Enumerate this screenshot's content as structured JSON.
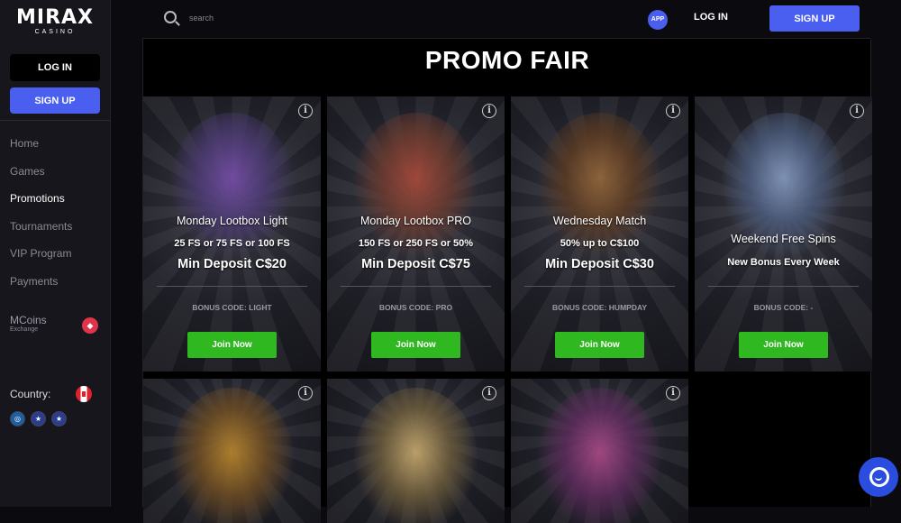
{
  "sidebar": {
    "logo_main": "MIRAX",
    "logo_sub": "CASINO",
    "login_label": "LOG IN",
    "signup_label": "SIGN UP",
    "nav": [
      {
        "label": "Home",
        "active": false
      },
      {
        "label": "Games",
        "active": false
      },
      {
        "label": "Promotions",
        "active": true
      },
      {
        "label": "Tournaments",
        "active": false
      },
      {
        "label": "VIP Program",
        "active": false
      },
      {
        "label": "Payments",
        "active": false
      }
    ],
    "mcoins_label": "MCoins",
    "mcoins_sub": "Exchange",
    "country_label": "Country:"
  },
  "header": {
    "search_placeholder": "search",
    "app_label": "APP",
    "login_label": "LOG IN",
    "signup_label": "SIGN UP"
  },
  "main": {
    "title": "PROMO FAIR",
    "cards": [
      {
        "title": "Monday Lootbox Light",
        "offer": "25 FS or 75 FS or 100 FS",
        "min": "Min Deposit C$20",
        "code": "BONUS CODE: LIGHT",
        "button": "Join Now",
        "art_color": "#7a4fb0"
      },
      {
        "title": "Monday Lootbox PRO",
        "offer": "150 FS or 250 FS or 50%",
        "min": "Min Deposit C$75",
        "code": "BONUS CODE: PRO",
        "button": "Join Now",
        "art_color": "#b04a3a"
      },
      {
        "title": "Wednesday Match",
        "offer": "50% up to C$100",
        "min": "Min Deposit C$30",
        "code": "BONUS CODE: HUMPDAY",
        "button": "Join Now",
        "art_color": "#9a6a3a"
      },
      {
        "title": "Weekend Free Spins",
        "offer": "New Bonus Every Week",
        "min": "",
        "code": "BONUS CODE: -",
        "button": "Join Now",
        "art_color": "#8aa0c8"
      }
    ]
  },
  "colors": {
    "accent": "#4a5ef0",
    "join_green": "#2fb81f"
  }
}
